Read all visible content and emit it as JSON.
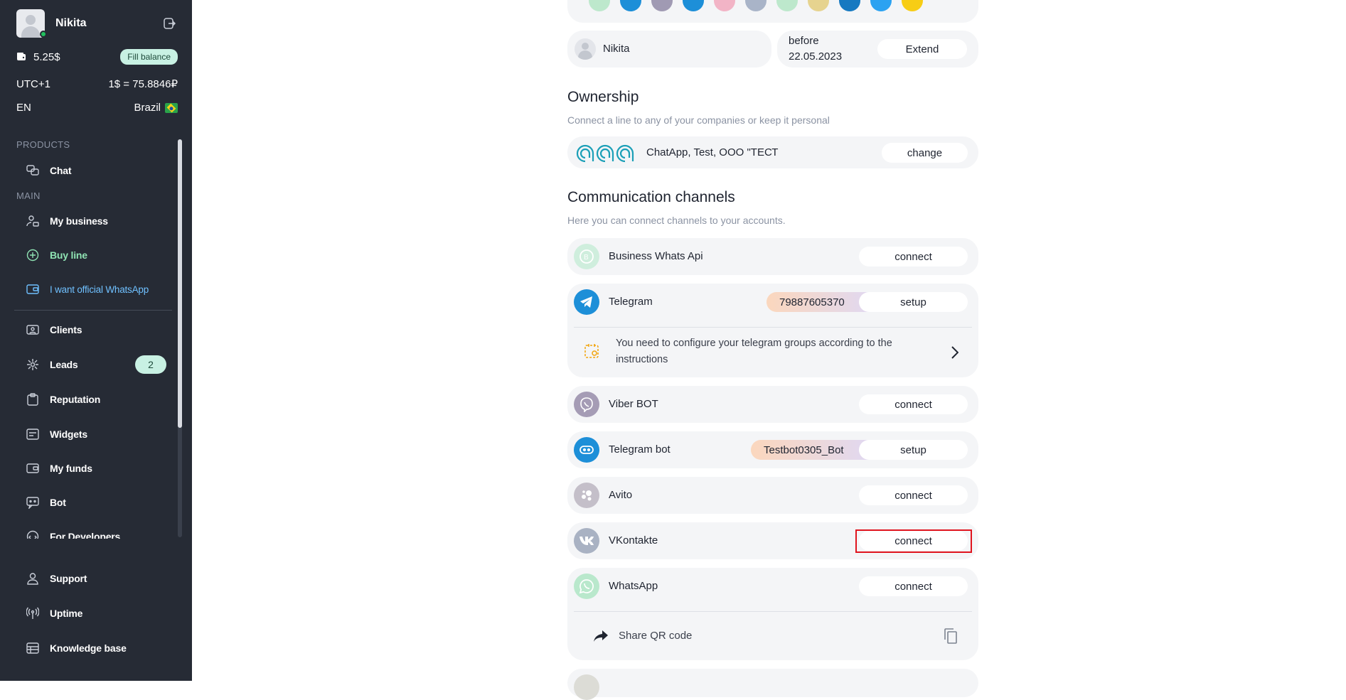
{
  "user": {
    "name": "Nikita",
    "balance": "5.25$",
    "fill_balance": "Fill balance"
  },
  "settings": {
    "timezone": "UTC+1",
    "rate": "1$ = 75.8846₽",
    "language": "EN",
    "country": "Brazil",
    "country_flag": "🇧🇷"
  },
  "nav": {
    "products_label": "PRODUCTS",
    "main_label": "MAIN",
    "chat": "Chat",
    "my_business": "My business",
    "buy_line": "Buy line",
    "official_whatsapp": "I want official WhatsApp",
    "clients": "Clients",
    "leads": "Leads",
    "leads_badge": "2",
    "reputation": "Reputation",
    "widgets": "Widgets",
    "my_funds": "My funds",
    "bot": "Bot",
    "for_developers": "For Developers",
    "support": "Support",
    "uptime": "Uptime",
    "knowledge_base": "Knowledge base"
  },
  "line": {
    "owner": "Nikita",
    "before_label": "before",
    "before_date": "22.05.2023",
    "extend": "Extend"
  },
  "ownership": {
    "title": "Ownership",
    "subtitle": "Connect a line to any of your companies or keep it personal",
    "companies": "ChatApp, Test, ООО \"ТЕСТ",
    "change": "change"
  },
  "channels": {
    "title": "Communication channels",
    "subtitle": "Here you can connect channels to your accounts.",
    "business_whats_api": {
      "name": "Business Whats Api",
      "action": "connect"
    },
    "telegram": {
      "name": "Telegram",
      "tag": "79887605370",
      "action": "setup",
      "notice": "You need to configure your telegram groups according to the instructions"
    },
    "viber": {
      "name": "Viber BOT",
      "action": "connect"
    },
    "telegram_bot": {
      "name": "Telegram bot",
      "tag": "Testbot0305_Bot",
      "action": "setup"
    },
    "avito": {
      "name": "Avito",
      "action": "connect"
    },
    "vk": {
      "name": "VKontakte",
      "action": "connect"
    },
    "whatsapp": {
      "name": "WhatsApp",
      "action": "connect",
      "share_qr": "Share QR code"
    }
  },
  "colors": {
    "sidebar_bg": "#262b35",
    "accent_green": "#c8f1e3",
    "card_bg": "#f4f5f7",
    "highlight_red": "#e0141e",
    "telegram_blue": "#1d8fd8"
  }
}
